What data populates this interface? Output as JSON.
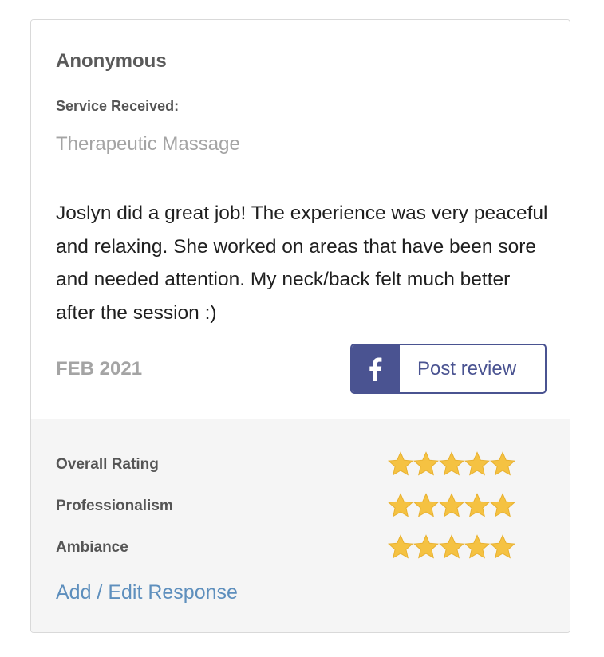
{
  "review": {
    "reviewer_name": "Anonymous",
    "service_label": "Service Received:",
    "service_value": "Therapeutic Massage",
    "text": "Joslyn did a great job! The experience was very peaceful and relaxing. She worked on areas that have been sore and needed attention. My neck/back felt much better after the session :)",
    "date": "FEB 2021"
  },
  "facebook_button": {
    "icon": "facebook-icon",
    "label": "Post review",
    "color": "#4a5391"
  },
  "ratings": [
    {
      "label": "Overall Rating",
      "stars": 5,
      "max": 5
    },
    {
      "label": "Professionalism",
      "stars": 5,
      "max": 5
    },
    {
      "label": "Ambiance",
      "stars": 5,
      "max": 5
    }
  ],
  "actions": {
    "add_edit_response": "Add / Edit Response"
  },
  "colors": {
    "star": "#f5c242",
    "link": "#5e8fbd",
    "footer_bg": "#f5f5f5"
  }
}
